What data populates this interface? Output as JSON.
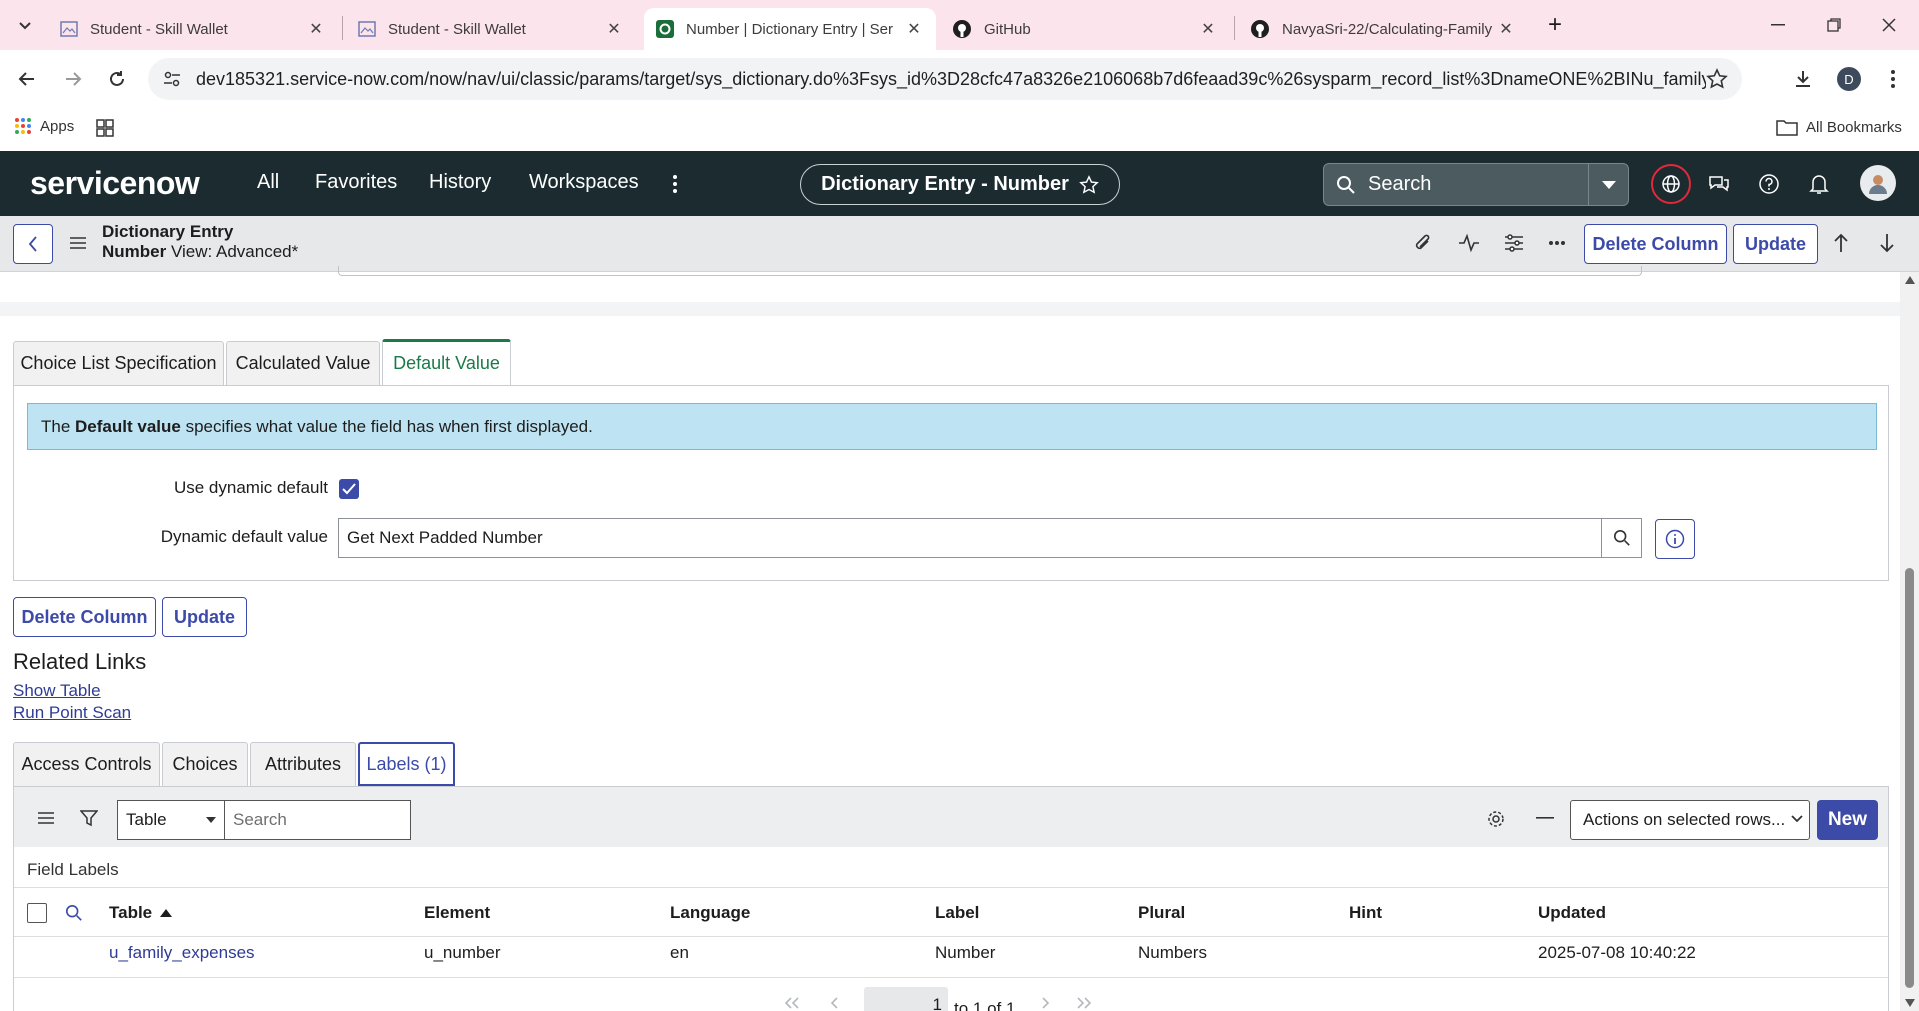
{
  "browser": {
    "tabs": [
      {
        "title": "Student - Skill Wallet"
      },
      {
        "title": "Student - Skill Wallet"
      },
      {
        "title": "Number | Dictionary Entry | Ser"
      },
      {
        "title": "GitHub"
      },
      {
        "title": "NavyaSri-22/Calculating-Family"
      }
    ],
    "url": "dev185321.service-now.com/now/nav/ui/classic/params/target/sys_dictionary.do%3Fsys_id%3D28cfc47a8326e2106068b7d6feaad39c%26sysparm_record_list%3DnameONE%2BINu_family_expens...",
    "bookmarks": {
      "apps": "Apps",
      "all": "All Bookmarks"
    },
    "profile_letter": "D"
  },
  "sn_header": {
    "logo": "servicenow",
    "nav": [
      "All",
      "Favorites",
      "History",
      "Workspaces"
    ],
    "context_title": "Dictionary Entry - Number",
    "search_placeholder": "Search"
  },
  "form_header": {
    "title_line1": "Dictionary Entry",
    "title_line2": "Number",
    "view": "View: Advanced*",
    "delete_label": "Delete Column",
    "update_label": "Update"
  },
  "tabs": [
    "Choice List Specification",
    "Calculated Value",
    "Default Value"
  ],
  "default_value": {
    "info_prefix": "The ",
    "info_bold": "Default value",
    "info_suffix": " specifies what value the field has when first displayed.",
    "use_dynamic_label": "Use dynamic default",
    "use_dynamic_checked": true,
    "dynamic_value_label": "Dynamic default value",
    "dynamic_value": "Get Next Padded Number"
  },
  "bottom_buttons": {
    "delete": "Delete Column",
    "update": "Update"
  },
  "related_links": {
    "heading": "Related Links",
    "links": [
      "Show Table",
      "Run Point Scan"
    ]
  },
  "related_tabs": [
    "Access Controls",
    "Choices",
    "Attributes",
    "Labels (1)"
  ],
  "list": {
    "select_value": "Table",
    "search_placeholder": "Search",
    "actions_label": "Actions on selected rows...",
    "new_label": "New",
    "section_title": "Field Labels",
    "columns": [
      "Table",
      "Element",
      "Language",
      "Label",
      "Plural",
      "Hint",
      "Updated"
    ],
    "rows": [
      [
        "u_family_expenses",
        "u_number",
        "en",
        "Number",
        "Numbers",
        "",
        "2025-07-08 10:40:22"
      ]
    ],
    "pagination": {
      "current": "1",
      "text": "to 1 of 1"
    }
  }
}
